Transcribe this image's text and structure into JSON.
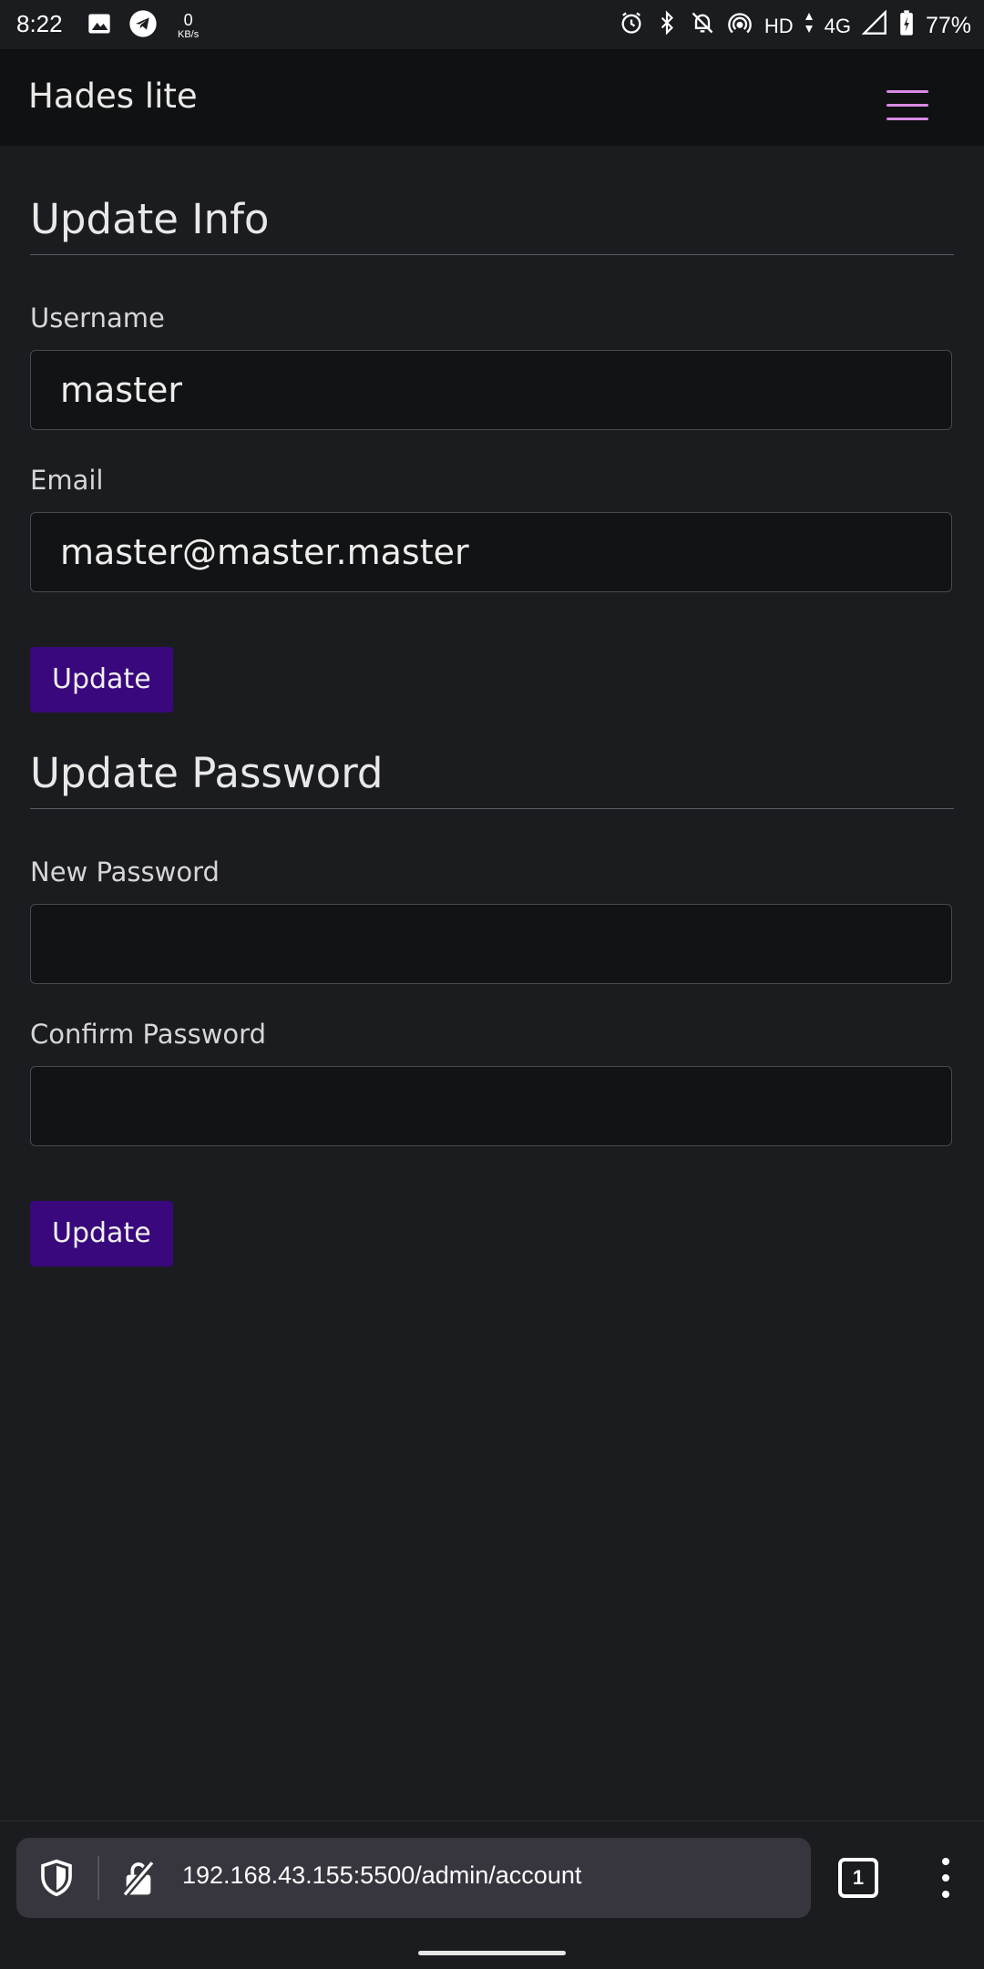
{
  "status_bar": {
    "time": "8:22",
    "net_speed_value": "0",
    "net_speed_unit": "KB/s",
    "network_hd": "HD",
    "network_type": "4G",
    "battery": "77%"
  },
  "navbar": {
    "brand": "Hades lite"
  },
  "update_info": {
    "title": "Update Info",
    "username_label": "Username",
    "username_value": "master",
    "email_label": "Email",
    "email_value": "master@master.master",
    "button": "Update"
  },
  "update_password": {
    "title": "Update Password",
    "new_password_label": "New Password",
    "new_password_value": "",
    "confirm_password_label": "Confirm Password",
    "confirm_password_value": "",
    "button": "Update"
  },
  "browser_bar": {
    "url": "192.168.43.155:5500/admin/account",
    "tab_count": "1"
  },
  "colors": {
    "background": "#1b1c1f",
    "navbar": "#101112",
    "button": "#38087c",
    "hamburger": "#d98ae6",
    "input_bg": "#121314"
  }
}
